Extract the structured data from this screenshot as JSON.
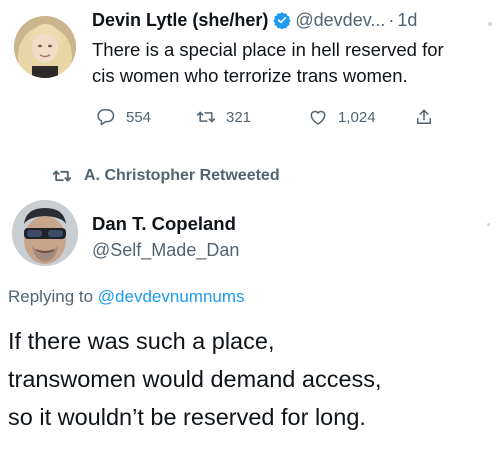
{
  "tweet": {
    "display_name": "Devin Lytle (she/her)",
    "handle": "@devdev...",
    "separator": "·",
    "time": "1d",
    "text_lines": [
      "There is a special place in hell reserved for",
      "cis women who terrorize trans women."
    ],
    "stats": {
      "replies": "554",
      "retweets": "321",
      "likes": "1,024"
    }
  },
  "retweet_banner": {
    "text": "A. Christopher Retweeted"
  },
  "reply_tweet": {
    "display_name": "Dan T. Copeland",
    "handle": "@Self_Made_Dan",
    "replying_prefix": "Replying to",
    "replying_handle": "@devdevnumnums",
    "text_lines": [
      "If there was such a place,",
      "transwomen would demand access,",
      "so it wouldn’t be reserved for long."
    ]
  },
  "colors": {
    "text": "#0f1419",
    "secondary": "#536471",
    "link": "#1d9bf0",
    "verified": "#1d9bf0"
  },
  "icons": [
    "reply-icon",
    "retweet-icon",
    "like-icon",
    "share-icon",
    "verified-badge-icon",
    "retweeted-icon"
  ]
}
